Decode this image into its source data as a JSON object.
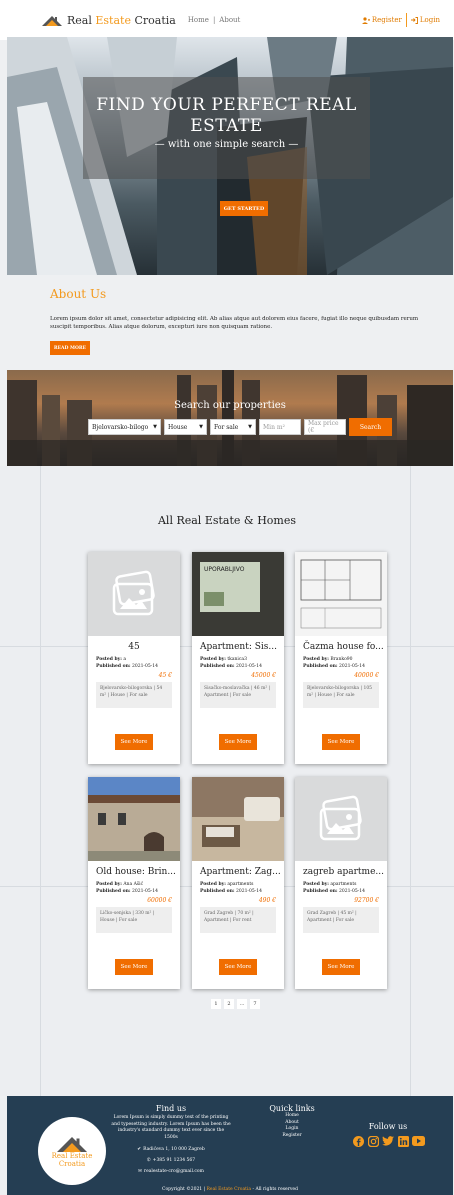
{
  "nav": {
    "brand_prefix": "Real ",
    "brand_highlight": "Estate",
    "brand_suffix": " Croatia",
    "links": [
      "Home",
      "About"
    ],
    "register_label": "Register",
    "login_label": "Login"
  },
  "hero": {
    "title_line1": "FIND YOUR PERFECT REAL",
    "title_line2": "ESTATE",
    "subtitle": "— with one simple search —",
    "button_label": "GET STARTED"
  },
  "about": {
    "title": "About Us",
    "text": "Lorem ipsum dolor sit amet, consectetur adipisicing elit. Ab alias atque aut dolorem eius facere, fugiat illo neque quibusdam rerum suscipit temporibus. Alias atque dolorum, excepturi iure non quisquam ratione.",
    "button_label": "READ MORE"
  },
  "search": {
    "title": "Search our properties",
    "county_value": "Bjelovarsko-bilogo",
    "type_value": "House",
    "status_value": "For sale",
    "min_placeholder": "Min m²",
    "max_placeholder": "Max price (€",
    "button_label": "Search"
  },
  "listings": {
    "title": "All Real Estate & Homes",
    "posted_by_label": "Posted by:",
    "published_label": "Published on:",
    "see_more_label": "See More",
    "cards": [
      {
        "title": "45",
        "posted_by": "a",
        "published": "2021-05-14",
        "price": "45 €",
        "info": "Bjelovarsko-bilogorska | 54 m² | House | For sale",
        "image": "placeholder"
      },
      {
        "title": "Apartment: Sis...",
        "posted_by": "tkanica3",
        "published": "2021-05-14",
        "price": "45000 €",
        "info": "Sisačko-moslavačka | 46 m² | Apartment | For sale",
        "image": "photo-sign",
        "sign_text": "UPORABLJIVO"
      },
      {
        "title": "Čazma house fo...",
        "posted_by": "Branko90",
        "published": "2021-05-14",
        "price": "40000 €",
        "info": "Bjelovarsko-bilogorska | 105 m² | House | For sale",
        "image": "photo-plan"
      },
      {
        "title": "Old house: Brin...",
        "posted_by": "Ana Ašić",
        "published": "2021-05-14",
        "price": "60000 €",
        "info": "Ličko-senjska | 330 m² | House | For sale",
        "image": "photo-house"
      },
      {
        "title": "Apartment: Zag...",
        "posted_by": "apartments",
        "published": "2021-05-14",
        "price": "490 €",
        "info": "Grad Zagreb | 70 m² | Apartment | For rent",
        "image": "photo-interior"
      },
      {
        "title": "zagreb apartme...",
        "posted_by": "apartments",
        "published": "2021-05-14",
        "price": "92700 €",
        "info": "Grad Zagreb | 45 m² | Apartment | For sale",
        "image": "placeholder"
      }
    ]
  },
  "pagination": [
    "1",
    "2",
    "...",
    "7"
  ],
  "footer": {
    "logo_line1": "Real Estate",
    "logo_line2": "Croatia",
    "find_title": "Find us",
    "find_text": "Lorem Ipsum is simply dummy text of the printing and typesetting industry. Lorem Ipsum has been the industry's standard dummy text ever since the 1500s",
    "address": "Radićeva 1, 10 000 Zagreb",
    "phone": "+385 91 1234 567",
    "email": "realestate-cro@gmail.com",
    "quick_title": "Quick links",
    "quick_links": [
      "Home",
      "About",
      "Login",
      "Register"
    ],
    "follow_title": "Follow us",
    "copyright_prefix": "Copyright ©2021 | ",
    "copyright_highlight": "Real Estate Croatia",
    "copyright_suffix": " - All rights reserved"
  },
  "colors": {
    "accent": "#f06d00",
    "brand": "#f39a1e",
    "footer": "#253e53"
  }
}
